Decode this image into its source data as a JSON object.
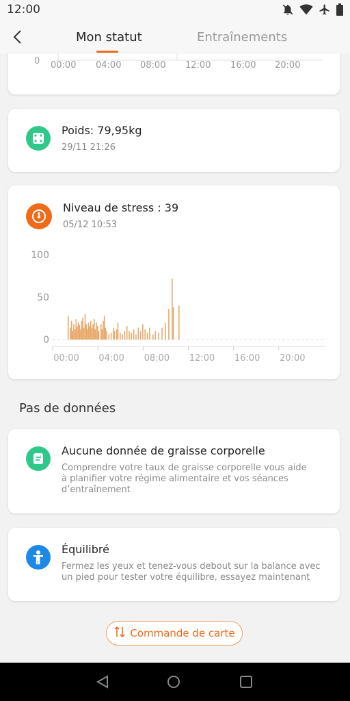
{
  "status_bar": {
    "time": "12:00",
    "icons": [
      "mute-icon",
      "wifi-icon",
      "airplane-icon",
      "battery-icon"
    ]
  },
  "header": {
    "tabs": [
      {
        "label": "Mon statut",
        "active": true
      },
      {
        "label": "Entraînements",
        "active": false
      }
    ]
  },
  "top_chart": {
    "y_zero_label": "0",
    "x_ticks": [
      "00:00",
      "04:00",
      "08:00",
      "12:00",
      "16:00",
      "20:00"
    ]
  },
  "weight_card": {
    "title": "Poids: 79,95kg",
    "timestamp": "29/11 21:26",
    "icon_color": "#2ec98a"
  },
  "stress_card": {
    "title": "Niveau de stress : 39",
    "timestamp": "05/12 10:53",
    "icon_color": "#f06a1a",
    "bar_color": "#e8a96b"
  },
  "chart_data": {
    "type": "bar",
    "xlabel": "",
    "ylabel": "",
    "ylim": [
      0,
      100
    ],
    "y_ticks": [
      "100",
      "50",
      "0"
    ],
    "x_ticks": [
      "00:00",
      "04:00",
      "08:00",
      "12:00",
      "16:00",
      "20:00"
    ],
    "xlim_hours": [
      0,
      24
    ],
    "bars": [
      {
        "h": 0.6,
        "v": 28
      },
      {
        "h": 0.8,
        "v": 14
      },
      {
        "h": 0.9,
        "v": 22
      },
      {
        "h": 1.0,
        "v": 10
      },
      {
        "h": 1.1,
        "v": 18
      },
      {
        "h": 1.2,
        "v": 12
      },
      {
        "h": 1.3,
        "v": 24
      },
      {
        "h": 1.4,
        "v": 15
      },
      {
        "h": 1.5,
        "v": 20
      },
      {
        "h": 1.6,
        "v": 17
      },
      {
        "h": 1.7,
        "v": 12
      },
      {
        "h": 1.8,
        "v": 22
      },
      {
        "h": 1.9,
        "v": 26
      },
      {
        "h": 2.0,
        "v": 14
      },
      {
        "h": 2.1,
        "v": 30
      },
      {
        "h": 2.2,
        "v": 18
      },
      {
        "h": 2.3,
        "v": 12
      },
      {
        "h": 2.4,
        "v": 20
      },
      {
        "h": 2.5,
        "v": 16
      },
      {
        "h": 2.6,
        "v": 22
      },
      {
        "h": 2.7,
        "v": 14
      },
      {
        "h": 2.8,
        "v": 18
      },
      {
        "h": 2.9,
        "v": 24
      },
      {
        "h": 3.0,
        "v": 12
      },
      {
        "h": 3.1,
        "v": 20
      },
      {
        "h": 3.2,
        "v": 16
      },
      {
        "h": 3.3,
        "v": 10
      },
      {
        "h": 3.5,
        "v": 18
      },
      {
        "h": 3.6,
        "v": 12
      },
      {
        "h": 3.7,
        "v": 22
      },
      {
        "h": 3.8,
        "v": 28
      },
      {
        "h": 3.9,
        "v": 14
      },
      {
        "h": 4.0,
        "v": 10
      },
      {
        "h": 4.2,
        "v": 6
      },
      {
        "h": 4.4,
        "v": 8
      },
      {
        "h": 4.6,
        "v": 14
      },
      {
        "h": 4.7,
        "v": 10
      },
      {
        "h": 4.9,
        "v": 12
      },
      {
        "h": 5.0,
        "v": 20
      },
      {
        "h": 5.2,
        "v": 8
      },
      {
        "h": 5.4,
        "v": 6
      },
      {
        "h": 5.6,
        "v": 10
      },
      {
        "h": 5.8,
        "v": 16
      },
      {
        "h": 6.0,
        "v": 10
      },
      {
        "h": 6.2,
        "v": 8
      },
      {
        "h": 6.4,
        "v": 12
      },
      {
        "h": 6.6,
        "v": 6
      },
      {
        "h": 6.8,
        "v": 14
      },
      {
        "h": 7.0,
        "v": 10
      },
      {
        "h": 7.2,
        "v": 18
      },
      {
        "h": 7.4,
        "v": 12
      },
      {
        "h": 7.6,
        "v": 8
      },
      {
        "h": 7.8,
        "v": 14
      },
      {
        "h": 8.1,
        "v": 6
      },
      {
        "h": 8.3,
        "v": 10
      },
      {
        "h": 8.6,
        "v": 8
      },
      {
        "h": 8.9,
        "v": 14
      },
      {
        "h": 9.2,
        "v": 20
      },
      {
        "h": 9.5,
        "v": 36
      },
      {
        "h": 9.8,
        "v": 72
      },
      {
        "h": 9.9,
        "v": 38
      },
      {
        "h": 10.4,
        "v": 40
      }
    ]
  },
  "section_title": "Pas de données",
  "fat_card": {
    "title": "Aucune donnée de graisse corporelle",
    "description_lines": [
      "Comprendre votre taux de graisse corporelle vous aide",
      "à planifier votre régime alimentaire et vos séances",
      "d’entraînement"
    ],
    "icon_color": "#2ec98a"
  },
  "balance_card": {
    "title": "Équilibré",
    "description_lines": [
      "Fermez les yeux et tenez-vous debout sur la balance avec",
      "un pied pour tester votre équilibre, essayez maintenant"
    ],
    "icon_color": "#1e88e5"
  },
  "order_button": {
    "label": "Commande de carte",
    "icon": "sort-arrows-icon"
  },
  "nav_bar": {
    "buttons": [
      "back-triangle-icon",
      "home-circle-icon",
      "recents-square-icon"
    ]
  }
}
